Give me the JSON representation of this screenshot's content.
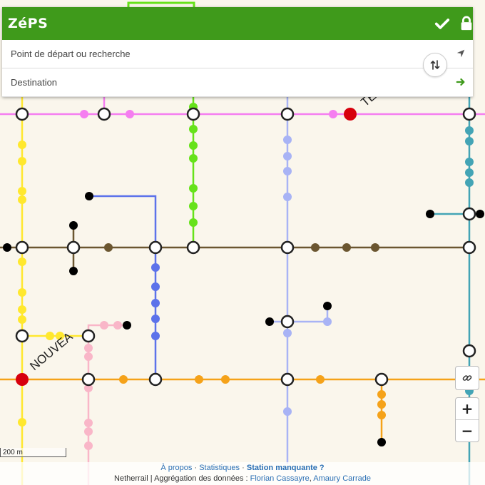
{
  "app": {
    "title": "ZéPS"
  },
  "search": {
    "origin_placeholder": "Point de départ ou recherche",
    "destination_placeholder": "Destination"
  },
  "icons": {
    "confirm": "checkmark-icon",
    "lock": "lock-icon",
    "locate": "location-arrow-icon",
    "go": "arrow-right-icon",
    "swap": "swap-vertical-icon",
    "link": "link-icon"
  },
  "map": {
    "labels": [
      "NOUVEA",
      "TE"
    ],
    "scale_label": "200 m",
    "line_colors": {
      "pink": "#f57ef0",
      "yellow": "#ffe82e",
      "green": "#66e21a",
      "periwinkle": "#a8b3f5",
      "teal": "#43a4b5",
      "brown": "#6b5630",
      "blue": "#5c72ea",
      "light_pink": "#f9b6c8",
      "orange": "#f5a219"
    },
    "colors": {
      "background": "#faf6ec",
      "header": "#3f9a1b"
    }
  },
  "zoom": {
    "in_label": "+",
    "out_label": "−"
  },
  "footer": {
    "about": "À propos",
    "stats": "Statistiques",
    "missing": "Station manquante ?",
    "credits_prefix": "Netherrail | Aggrégation des données :",
    "author1": "Florian Cassayre",
    "author2": "Amaury Carrade"
  }
}
